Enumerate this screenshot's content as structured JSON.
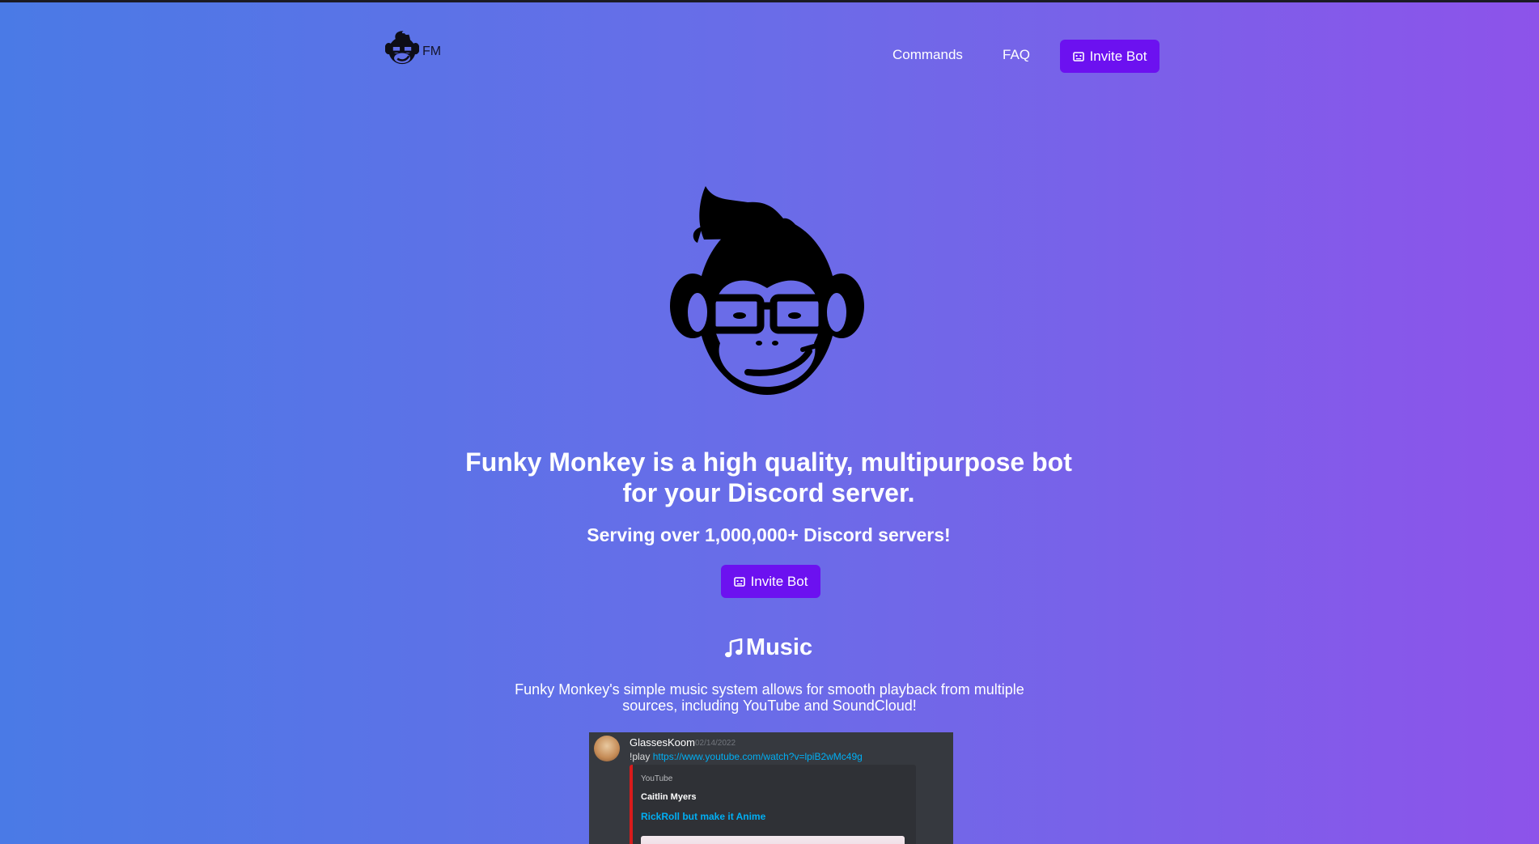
{
  "header": {
    "logo_text": "FM",
    "nav": [
      {
        "label": "Commands"
      },
      {
        "label": "FAQ"
      }
    ],
    "invite_label": "Invite Bot"
  },
  "hero": {
    "headline": "Funky Monkey is a high quality, multipurpose bot for your Discord server.",
    "subheadline": "Serving over 1,000,000+ Discord servers!",
    "invite_label": "Invite Bot"
  },
  "music": {
    "title": "Music",
    "description": "Funky Monkey's simple music system allows for smooth playback from multiple sources, including YouTube and SoundCloud!"
  },
  "discord_preview": {
    "username": "GlassesKoom",
    "timestamp": "02/14/2022",
    "command": "!play",
    "link": "https://www.youtube.com/watch?v=lpiB2wMc49g",
    "embed": {
      "provider": "YouTube",
      "author": "Caitlin Myers",
      "title": "RickRoll but make it Anime"
    }
  },
  "colors": {
    "gradient_start": "#4a7ae6",
    "gradient_end": "#8d53ea",
    "button": "#6c11f0",
    "embed_border": "#d91b1b",
    "link": "#00aff4"
  }
}
